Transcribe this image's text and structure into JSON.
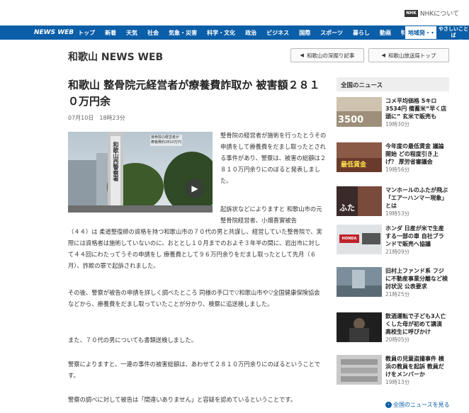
{
  "topbar": {
    "about_label": "NHKについて",
    "nhk_mark": "NHK"
  },
  "nav": {
    "logo": "NEWS WEB",
    "items": [
      "トップ",
      "新着",
      "天気",
      "社会",
      "気象・災害",
      "科学・文化",
      "政治",
      "ビジネス",
      "国際",
      "スポーツ",
      "暮らし",
      "動画",
      "特集"
    ],
    "region_label": "地域発・",
    "easy_label_1": "やさしいことば",
    "easy_label_2": "ニュース"
  },
  "station": {
    "title": "和歌山 NEWS WEB",
    "btn_feature": "和歌山の深掘り記事",
    "btn_top": "和歌山放送局トップ"
  },
  "article": {
    "title": "和歌山 整骨院元経営者が療養費詐取か 被害額２８１０万円余",
    "date": "07月10日　18時23分",
    "photo_caption_1": "接骨院の経営者が",
    "photo_caption_2": "療養費約2810万円",
    "photo_sign": "和歌山西警察署",
    "p1": "整骨院の経営者が施術を行ったとうその申請をして療養費をだまし取ったとされる事件があり、警察は、被害の総額は２８１０万円余りにのぼると発表しました。",
    "p2a": "起訴状などによりますと 和歌山市の元整骨院経営者、小畑喜實被告",
    "p2": "（４４）は 柔道整復師の資格を持つ和歌山市の７０代の男と共謀し、経営していた整骨院で、実際には資格者は施術していないのに、おととし１０月までのおよそ３年半の間に、岩出市に対して４４回にわたってうその申請をし 療養費として９６万円余りをだまし取ったとして先月（６月）、詐欺の罪で起訴されました。",
    "p3": "その後、警察が被告の申請を詳しく調べたところ 同様の手口で▽和歌山市や▽全国健康保険協会などから、療養費をだまし取っていたことが分かり、検察に追送検しました。",
    "p4": "また、７０代の男についても書類送検しました。",
    "p5": "警察によりますと、一連の事件の被害総額は、あわせて２８１０万円余りにのぼるということです。",
    "p6": "警察の調べに対して被告は「間違いありません」と容疑を認めているということです。"
  },
  "sidebar": {
    "heading": "全国のニュース",
    "items": [
      {
        "title": "コメ平均価格 5キロ 3534円 備蓄米“早く店頭に” 玄米で販売も",
        "time": "19時30分",
        "thumb_text": "3500"
      },
      {
        "title": "今年度の最低賃金 議論開始 どの程度引き上げ？ 厚労省審議会",
        "time": "19時56分",
        "thumb_text": "最低賃金"
      },
      {
        "title": "マンホールのふたが飛ぶ「エアーハンマー現象」とは",
        "time": "19時53分",
        "thumb_text": "ふた"
      },
      {
        "title": "ホンダ 日産が米で生産する一部の車 自社ブランドで販売へ協議",
        "time": "21時09分",
        "thumb_text": "HONDA"
      },
      {
        "title": "旧村上ファンド系 フジに不動産事業分離など検討状況 公表要求",
        "time": "21時25分",
        "thumb_text": ""
      },
      {
        "title": "飲酒運転で子ども3人亡くした母が初めて講演 高校生に呼びかけ",
        "time": "20時05分",
        "thumb_text": ""
      },
      {
        "title": "教員の児童盗撮事件 横浜の教員を起訴 教員だけをメンバーか",
        "time": "19時13分",
        "thumb_text": ""
      }
    ],
    "more_label": "全国のニュースを見る"
  }
}
